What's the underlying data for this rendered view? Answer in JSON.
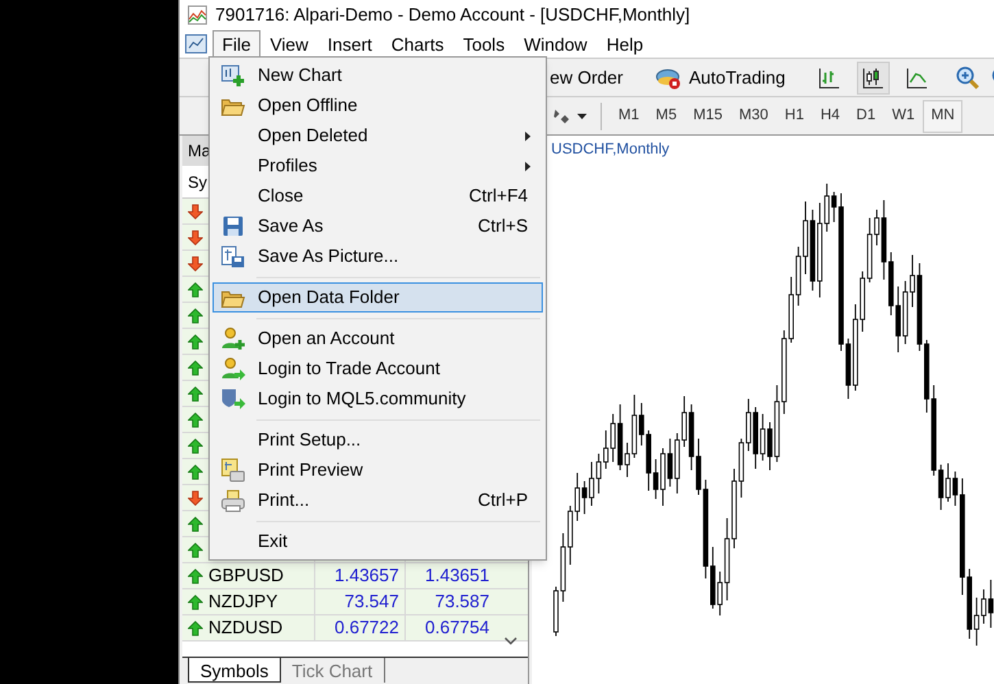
{
  "window": {
    "title": "7901716: Alpari-Demo - Demo Account - [USDCHF,Monthly]"
  },
  "menu_bar": [
    {
      "label": "File",
      "selected": true
    },
    {
      "label": "View",
      "selected": false
    },
    {
      "label": "Insert",
      "selected": false
    },
    {
      "label": "Charts",
      "selected": false
    },
    {
      "label": "Tools",
      "selected": false
    },
    {
      "label": "Window",
      "selected": false
    },
    {
      "label": "Help",
      "selected": false
    }
  ],
  "toolbar": {
    "new_order": "ew Order",
    "autotrading": "AutoTrading",
    "chart_types": [
      {
        "kind": "bars",
        "selected": false
      },
      {
        "kind": "candles",
        "selected": true
      },
      {
        "kind": "line",
        "selected": false
      }
    ],
    "periods": [
      {
        "label": "M1",
        "selected": false
      },
      {
        "label": "M5",
        "selected": false
      },
      {
        "label": "M15",
        "selected": false
      },
      {
        "label": "M30",
        "selected": false
      },
      {
        "label": "H1",
        "selected": false
      },
      {
        "label": "H4",
        "selected": false
      },
      {
        "label": "D1",
        "selected": false
      },
      {
        "label": "W1",
        "selected": false
      },
      {
        "label": "MN",
        "selected": true
      }
    ]
  },
  "market_watch": {
    "title": "Ma",
    "column_1": "Sy",
    "rows": [
      {
        "rising": false
      },
      {
        "rising": false
      },
      {
        "rising": false
      },
      {
        "rising": true
      },
      {
        "rising": true
      },
      {
        "rising": true
      },
      {
        "rising": true
      },
      {
        "rising": true
      },
      {
        "rising": true
      },
      {
        "rising": true
      },
      {
        "rising": true
      },
      {
        "rising": false
      },
      {
        "rising": true
      },
      {
        "rising": true
      },
      {
        "rising": true,
        "symbol": "GBPUSD",
        "bid": "1.43657",
        "ask": "1.43651"
      },
      {
        "rising": true,
        "symbol": "NZDJPY",
        "bid": "73.547",
        "ask": "73.587"
      },
      {
        "rising": true,
        "symbol": "NZDUSD",
        "bid": "0.67722",
        "ask": "0.67754"
      }
    ],
    "tabs": [
      {
        "label": "Symbols",
        "selected": true
      },
      {
        "label": "Tick Chart",
        "selected": false
      }
    ]
  },
  "chart": {
    "title": "USDCHF,Monthly"
  },
  "file_menu": [
    {
      "kind": "item",
      "label": "New Chart"
    },
    {
      "kind": "item",
      "label": "Open Offline"
    },
    {
      "kind": "submenu",
      "label": "Open Deleted"
    },
    {
      "kind": "submenu",
      "label": "Profiles"
    },
    {
      "kind": "item",
      "label": "Close",
      "shortcut": "Ctrl+F4"
    },
    {
      "kind": "item",
      "label": "Save As",
      "shortcut": "Ctrl+S"
    },
    {
      "kind": "item",
      "label": "Save As Picture..."
    },
    {
      "kind": "separator"
    },
    {
      "kind": "item",
      "label": "Open Data Folder",
      "selected": true
    },
    {
      "kind": "separator"
    },
    {
      "kind": "item",
      "label": "Open an Account"
    },
    {
      "kind": "item",
      "label": "Login to Trade Account"
    },
    {
      "kind": "item",
      "label": "Login to MQL5.community"
    },
    {
      "kind": "separator"
    },
    {
      "kind": "item",
      "label": "Print Setup..."
    },
    {
      "kind": "item",
      "label": "Print Preview"
    },
    {
      "kind": "item",
      "label": "Print...",
      "shortcut": "Ctrl+P"
    },
    {
      "kind": "separator"
    },
    {
      "kind": "item",
      "label": "Exit"
    }
  ]
}
